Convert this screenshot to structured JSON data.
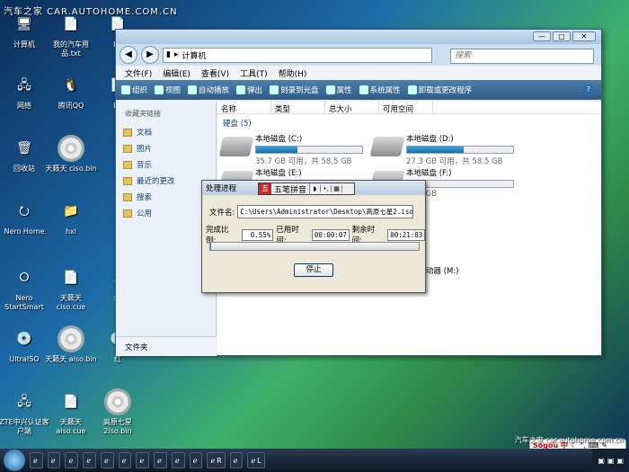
{
  "watermark": "汽车之家 CAR.AUTOHOME.COM.CN",
  "watermark2": "汽车之家 car.autohome.com.cn",
  "desktop": {
    "icons": [
      {
        "label": "计算机",
        "icon": "computer-icon",
        "glyph": "🖥"
      },
      {
        "label": "我的汽车用品.txt",
        "icon": "text-file-icon",
        "glyph": "📄"
      },
      {
        "label": "b.i",
        "icon": "file-icon",
        "glyph": "📄"
      },
      {
        "label": "网络",
        "icon": "network-icon",
        "glyph": "🖧"
      },
      {
        "label": "腾讯QQ",
        "icon": "qq-icon",
        "glyph": "🐧"
      },
      {
        "label": "b.l",
        "icon": "file-icon",
        "glyph": "📄"
      },
      {
        "label": "回收站",
        "icon": "recycle-bin-icon",
        "glyph": "🗑"
      },
      {
        "label": "天籁天 ciso.bin",
        "icon": "disc-icon",
        "glyph": ""
      },
      {
        "label": "Nero Home",
        "icon": "nero-home-icon",
        "glyph": "⭮"
      },
      {
        "label": "hxl",
        "icon": "folder-icon",
        "glyph": "📁"
      },
      {
        "label": "Nero StartSmart",
        "icon": "nero-startsmart-icon",
        "glyph": "⭘"
      },
      {
        "label": "天籁天 ciso.cue",
        "icon": "cue-file-icon",
        "glyph": "📄"
      },
      {
        "label": "红",
        "icon": "file-icon",
        "glyph": "5"
      },
      {
        "label": "UltraISO",
        "icon": "ultraiso-icon",
        "glyph": "💿"
      },
      {
        "label": "天籁天 aiso.bin",
        "icon": "disc-icon",
        "glyph": ""
      },
      {
        "label": "红",
        "icon": "file-icon",
        "glyph": "💿"
      },
      {
        "label": "ZTE中兴认证客户端",
        "icon": "zte-client-icon",
        "glyph": "🖧"
      },
      {
        "label": "天籁天 aiso.cue",
        "icon": "cue-file-icon",
        "glyph": "📄"
      },
      {
        "label": "高原七星 2iso.bin",
        "icon": "disc-icon",
        "glyph": ""
      }
    ]
  },
  "explorer": {
    "address": "计算机",
    "search_placeholder": "搜索",
    "menu": [
      "文件(F)",
      "编辑(E)",
      "查看(V)",
      "工具(T)",
      "帮助(H)"
    ],
    "toolbar": [
      "组织",
      "视图",
      "自动播放",
      "弹出",
      "刻录到光盘",
      "属性",
      "系统属性",
      "卸载或更改程序"
    ],
    "sidebar_header": "收藏夹链接",
    "favorites": [
      "文档",
      "图片",
      "音乐",
      "最近的更改",
      "搜索",
      "公用"
    ],
    "folders_label": "文件夹",
    "columns": [
      "名称",
      "类型",
      "总大小",
      "可用空间"
    ],
    "group": "硬盘 (5)",
    "drives": [
      {
        "name": "本地磁盘 (C:)",
        "free": "35.7 GB 可用，共 58.5 GB",
        "fill": 0.39
      },
      {
        "name": "本地磁盘 (D:)",
        "free": "27.3 GB 可用，共 58.5 GB",
        "fill": 0.53
      },
      {
        "name": "本地磁盘 (E:)",
        "free": "",
        "fill": 0.4
      },
      {
        "name": "本地磁盘 (F:)",
        "free": "58.5 GB",
        "fill": 0.1
      }
    ],
    "extra_label": "动器 (M:)"
  },
  "dialog": {
    "title": "处理进程",
    "file_label": "文件名:",
    "file_value": "C:\\Users\\Administrator\\Desktop\\高原七星2.iso.bin",
    "ratio_label": "完成比例:",
    "ratio_value": "0.55%",
    "elapsed_label": "已用时间:",
    "elapsed_value": "00:00:07",
    "remain_label": "剩余时间:",
    "remain_value": "00:21:03",
    "progress": 0.0055,
    "stop_label": "停止"
  },
  "ime": {
    "name": "五笔拼音"
  },
  "taskbar": {
    "items": [
      "",
      "",
      "",
      "",
      "",
      "",
      "",
      "",
      "",
      "",
      "R",
      "",
      "L"
    ]
  },
  "sogou": {
    "text": "Sogou 中"
  }
}
